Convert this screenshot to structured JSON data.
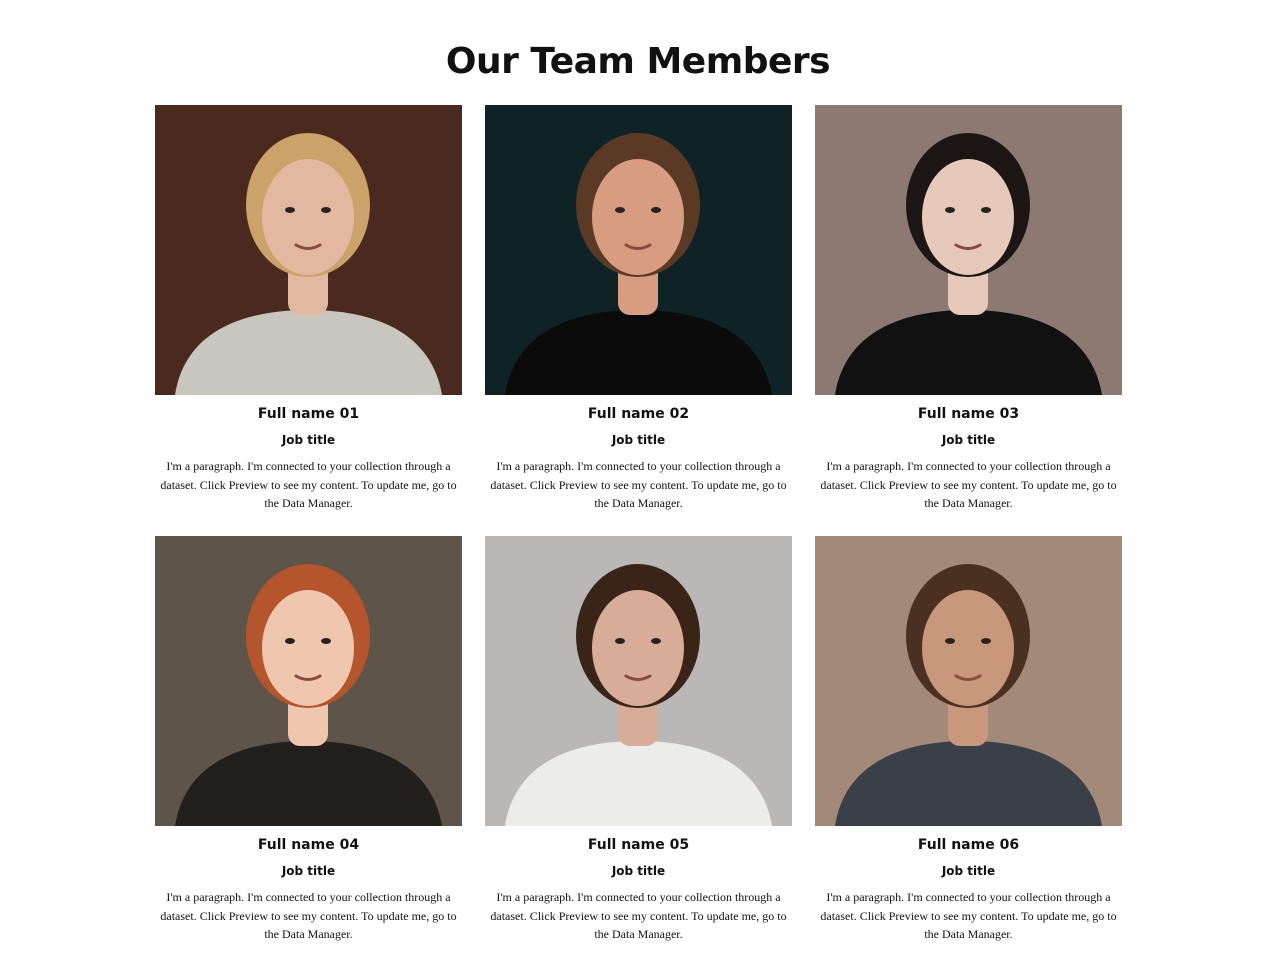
{
  "page": {
    "title": "Our Team Members"
  },
  "members": [
    {
      "name": "Full name 01",
      "job_title": "Job title",
      "bio": "I'm a paragraph. I'm connected to your collection through a dataset. Click Preview to see my content. To update me, go to the Data Manager.",
      "photo": {
        "bg": "#4a2a1f",
        "skin": "#e2b9a0",
        "hair": "#c9a36a",
        "top": "#c9c6bd"
      }
    },
    {
      "name": "Full name 02",
      "job_title": "Job title",
      "bio": "I'm a paragraph. I'm connected to your collection through a dataset. Click Preview to see my content. To update me, go to the Data Manager.",
      "photo": {
        "bg": "#0f2326",
        "skin": "#d89c80",
        "hair": "#5a3a24",
        "top": "#0b0b0b"
      }
    },
    {
      "name": "Full name 03",
      "job_title": "Job title",
      "bio": "I'm a paragraph. I'm connected to your collection through a dataset. Click Preview to see my content. To update me, go to the Data Manager.",
      "photo": {
        "bg": "#8c7a72",
        "skin": "#e7c9ba",
        "hair": "#1c1614",
        "top": "#111111"
      }
    },
    {
      "name": "Full name 04",
      "job_title": "Job title",
      "bio": "I'm a paragraph. I'm connected to your collection through a dataset. Click Preview to see my content. To update me, go to the Data Manager.",
      "photo": {
        "bg": "#5e544a",
        "skin": "#efc7ae",
        "hair": "#b5552d",
        "top": "#231f1c"
      }
    },
    {
      "name": "Full name 05",
      "job_title": "Job title",
      "bio": "I'm a paragraph. I'm connected to your collection through a dataset. Click Preview to see my content. To update me, go to the Data Manager.",
      "photo": {
        "bg": "#b9b8b7",
        "skin": "#d7ad98",
        "hair": "#3a2418",
        "top": "#ececea"
      }
    },
    {
      "name": "Full name 06",
      "job_title": "Job title",
      "bio": "I'm a paragraph. I'm connected to your collection through a dataset. Click Preview to see my content. To update me, go to the Data Manager.",
      "photo": {
        "bg": "#a38a78",
        "skin": "#c9977c",
        "hair": "#4a3020",
        "top": "#3b4048"
      }
    }
  ]
}
